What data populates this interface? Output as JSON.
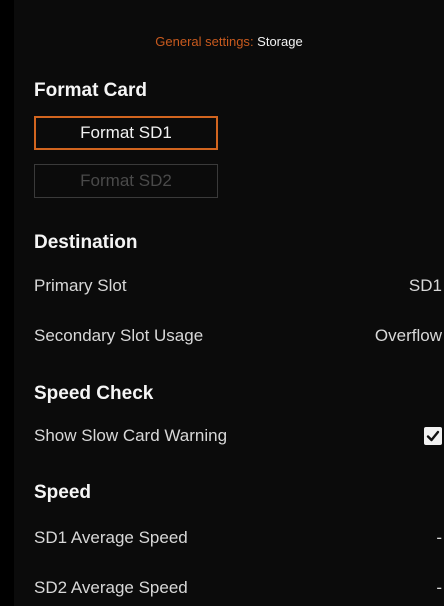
{
  "breadcrumb": {
    "parent": "General settings",
    "separator": ":",
    "current": " Storage"
  },
  "format_card": {
    "title": "Format Card",
    "buttons": [
      {
        "label": "Format SD1",
        "state": "active"
      },
      {
        "label": "Format SD2",
        "state": "disabled"
      }
    ]
  },
  "destination": {
    "title": "Destination",
    "rows": [
      {
        "label": "Primary Slot",
        "value": "SD1"
      },
      {
        "label": "Secondary Slot Usage",
        "value": "Overflow"
      }
    ]
  },
  "speed_check": {
    "title": "Speed Check",
    "rows": [
      {
        "label": "Show Slow Card Warning",
        "checked": true
      }
    ]
  },
  "speed": {
    "title": "Speed",
    "rows": [
      {
        "label": "SD1 Average Speed",
        "value": "-"
      },
      {
        "label": "SD2 Average Speed",
        "value": "-"
      }
    ]
  },
  "colors": {
    "accent": "#d2651f",
    "background": "#0b0b0b",
    "text": "#d8d8d8"
  }
}
